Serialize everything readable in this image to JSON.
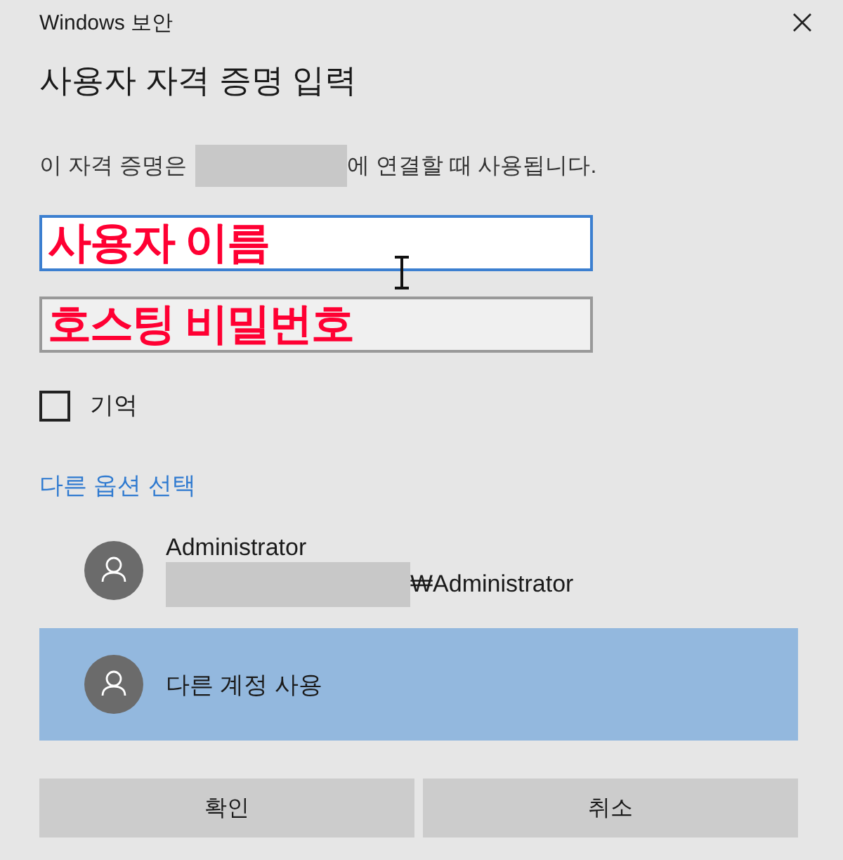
{
  "window": {
    "title": "Windows 보안"
  },
  "heading": "사용자 자격 증명 입력",
  "description": {
    "before": "이 자격 증명은",
    "after": "에 연결할 때 사용됩니다."
  },
  "fields": [
    {
      "focused": true,
      "annotation": "사용자 이름"
    },
    {
      "focused": false,
      "annotation": "호스팅 비밀번호"
    }
  ],
  "remember": {
    "label": "기억",
    "checked": false
  },
  "more_choices_link": "다른 옵션 선택",
  "accounts": [
    {
      "name": "Administrator",
      "detail": "₩Administrator",
      "selected": false
    },
    {
      "name": "다른 계정 사용",
      "selected": true
    }
  ],
  "buttons": [
    "확인",
    "취소"
  ]
}
